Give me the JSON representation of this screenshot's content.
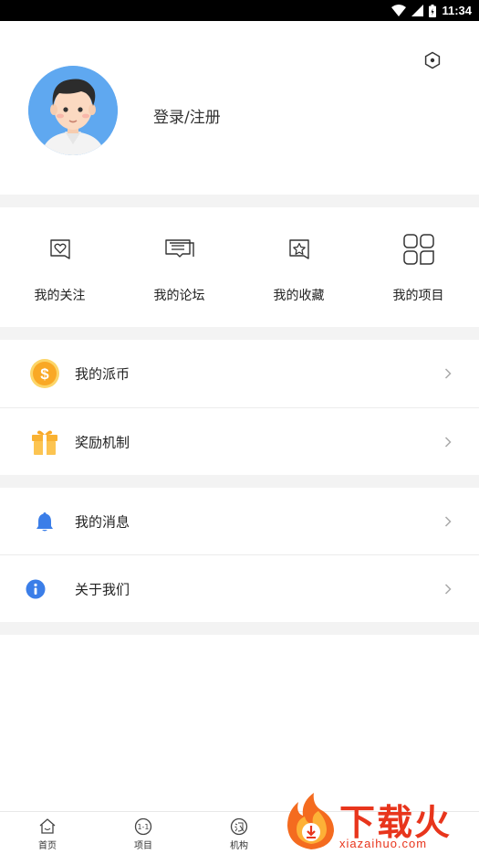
{
  "status_bar": {
    "time": "11:34"
  },
  "profile": {
    "login_label": "登录/注册"
  },
  "quick_actions": [
    {
      "label": "我的关注",
      "icon": "heart-tag-icon"
    },
    {
      "label": "我的论坛",
      "icon": "chat-bubbles-icon"
    },
    {
      "label": "我的收藏",
      "icon": "star-bookmark-icon"
    },
    {
      "label": "我的项目",
      "icon": "grid-apps-icon"
    }
  ],
  "menu": [
    {
      "label": "我的派币",
      "icon": "coin-dollar-icon"
    },
    {
      "label": "奖励机制",
      "icon": "gift-box-icon"
    },
    {
      "label": "我的消息",
      "icon": "bell-icon"
    },
    {
      "label": "关于我们",
      "icon": "info-icon"
    }
  ],
  "bottom_nav": [
    {
      "label": "首页",
      "icon": "home-icon"
    },
    {
      "label": "项目",
      "icon": "project-icon"
    },
    {
      "label": "机构",
      "icon": "institution-icon"
    }
  ],
  "watermark": {
    "title": "下载火",
    "subtitle": "xiazaihuo.com"
  },
  "colors": {
    "accent_orange": "#f9a825",
    "accent_blue": "#3b7ee8",
    "brand_red": "#e8351c",
    "avatar_bg": "#5fa8f0"
  }
}
